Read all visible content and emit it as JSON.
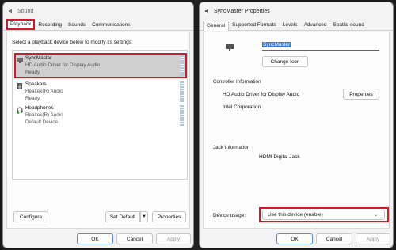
{
  "sound": {
    "title": "Sound",
    "tabs": [
      "Playback",
      "Recording",
      "Sounds",
      "Communications"
    ],
    "instruction": "Select a playback device below to modify its settings:",
    "devices": [
      {
        "name": "SyncMaster",
        "driver": "HD Audio Driver for Display Audio",
        "status": "Ready",
        "icon": "monitor-icon",
        "selected": true
      },
      {
        "name": "Speakers",
        "driver": "Realtek(R) Audio",
        "status": "Ready",
        "icon": "speaker-icon",
        "selected": false
      },
      {
        "name": "Headphones",
        "driver": "Realtek(R) Audio",
        "status": "Default Device",
        "icon": "headphones-icon",
        "selected": false
      }
    ],
    "configure_label": "Configure",
    "set_default_label": "Set Default",
    "properties_label": "Properties",
    "ok_label": "OK",
    "cancel_label": "Cancel",
    "apply_label": "Apply"
  },
  "props": {
    "title": "SyncMaster Properties",
    "tabs": [
      "General",
      "Supported Formats",
      "Levels",
      "Advanced",
      "Spatial sound"
    ],
    "device_name": "SyncMaster",
    "change_icon_label": "Change Icon",
    "controller_heading": "Controller Information",
    "controller_name": "HD Audio Driver for Display Audio",
    "controller_vendor": "Intel Corporation",
    "controller_properties_label": "Properties",
    "jack_heading": "Jack Information",
    "jack_value": "HDMI Digital Jack",
    "usage_label": "Device usage:",
    "usage_value": "Use this device (enable)",
    "ok_label": "OK",
    "cancel_label": "Cancel",
    "apply_label": "Apply"
  },
  "colors": {
    "highlight": "#d11a2a",
    "selection": "#cfcfcf",
    "accent": "#3a78d6"
  }
}
